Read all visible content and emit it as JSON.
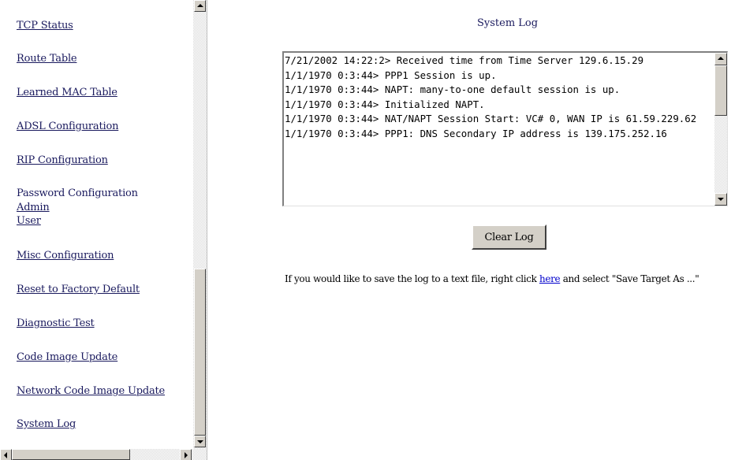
{
  "nav": {
    "items": [
      {
        "label": "TCP Status"
      },
      {
        "label": "Route Table"
      },
      {
        "label": "Learned MAC Table"
      },
      {
        "label": "ADSL Configuration"
      },
      {
        "label": "RIP Configuration"
      },
      {
        "label": "Password Configuration"
      },
      {
        "label": "Admin"
      },
      {
        "label": "User"
      },
      {
        "label": "Misc Configuration"
      },
      {
        "label": "Reset to Factory Default"
      },
      {
        "label": "Diagnostic Test"
      },
      {
        "label": "Code Image Update"
      },
      {
        "label": "Network Code Image Update"
      },
      {
        "label": "System Log"
      }
    ]
  },
  "main": {
    "title": "System Log",
    "log_text": "7/21/2002 14:22:2> Received time from Time Server 129.6.15.29\n1/1/1970 0:3:44> PPP1 Session is up.\n1/1/1970 0:3:44> NAPT: many-to-one default session is up.\n1/1/1970 0:3:44> Initialized NAPT.\n1/1/1970 0:3:44> NAT/NAPT Session Start: VC# 0, WAN IP is 61.59.229.62\n1/1/1970 0:3:44> PPP1: DNS Secondary IP address is 139.175.252.16",
    "clear_button": "Clear Log",
    "save_hint_before": "If you would like to save the log to a text file, right click ",
    "save_hint_link": "here",
    "save_hint_after": " and select \"Save Target As ...\""
  },
  "colors": {
    "link": "#1a1a5e",
    "hyperlink": "#0000cc",
    "button_face": "#d4d0c8"
  }
}
